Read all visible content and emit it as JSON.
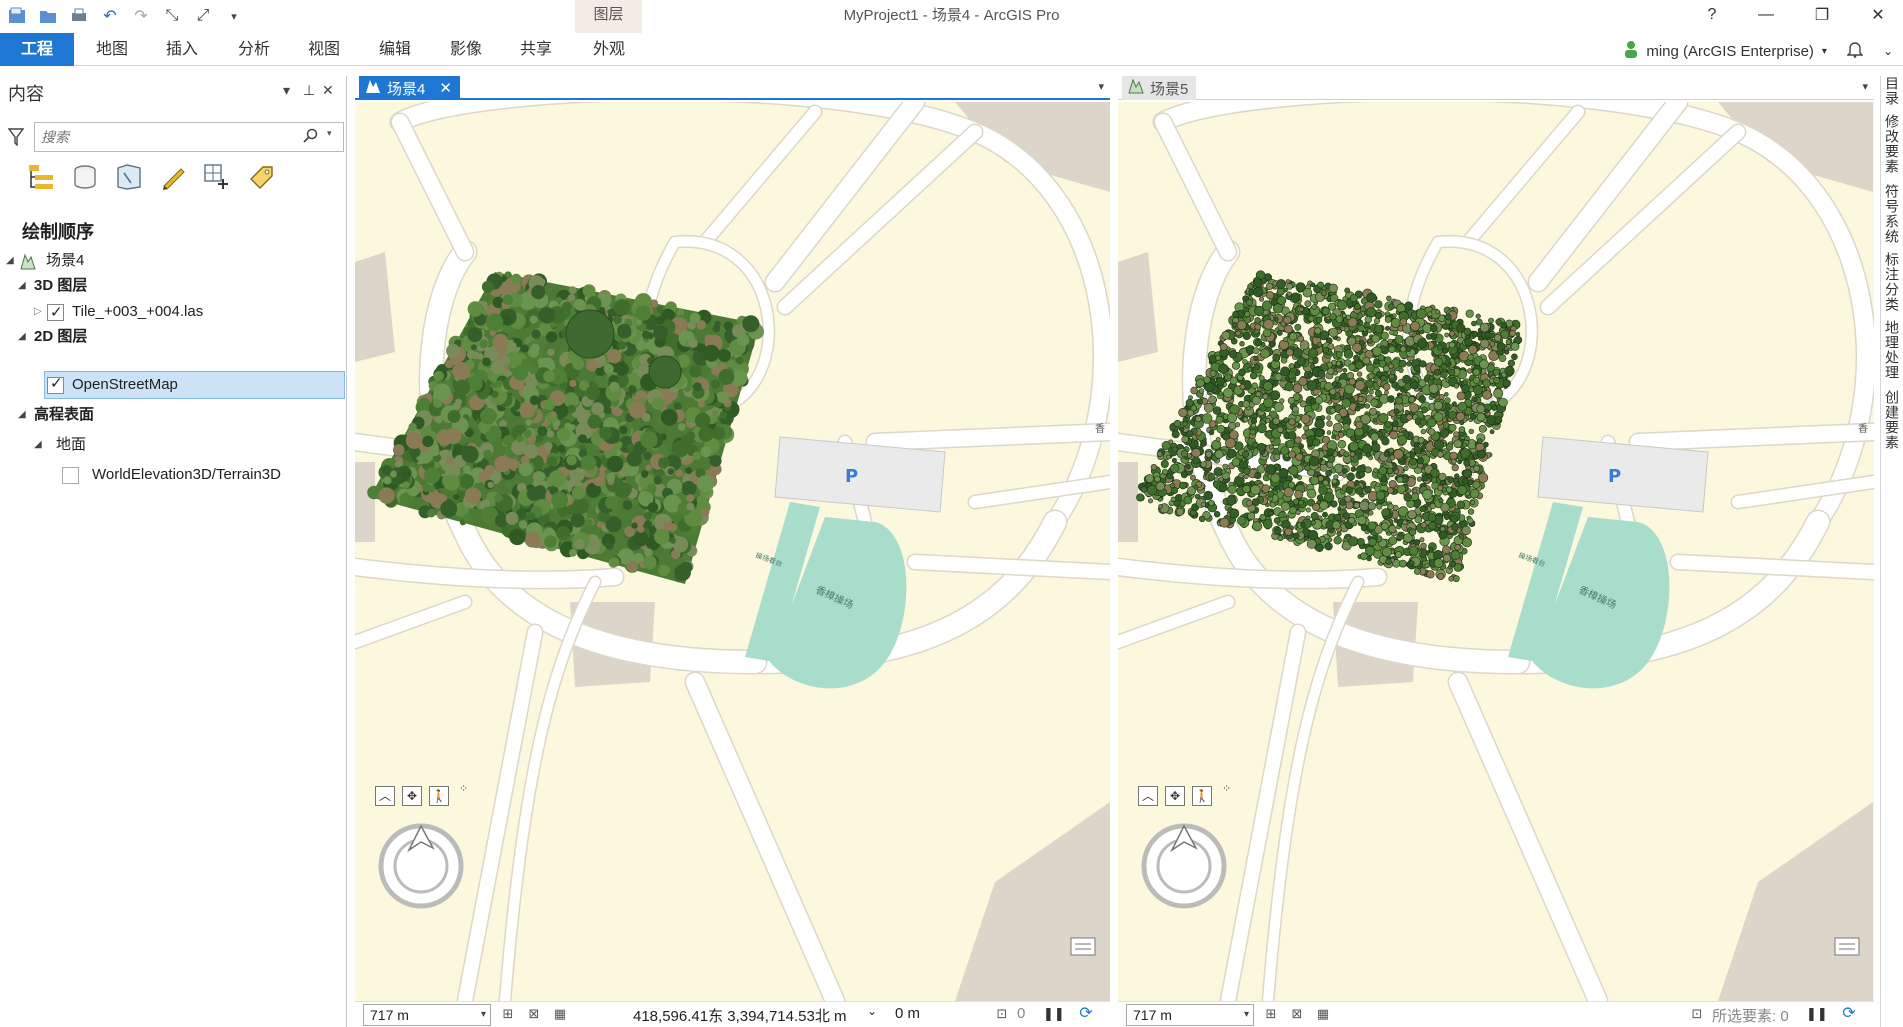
{
  "window": {
    "title": "MyProject1 - 场景4 - ArcGIS Pro",
    "context_tab_group": "图层",
    "controls": {
      "help": "?",
      "minimize": "—",
      "restore": "❐",
      "close": "✕"
    }
  },
  "quick_access": [
    "save-project-icon",
    "open-project-icon",
    "print-icon",
    "undo-icon",
    "redo-icon",
    "collapse-icon",
    "expand-icon",
    "customize-icon"
  ],
  "ribbon": {
    "tabs": [
      {
        "label": "工程",
        "active": true
      },
      {
        "label": "地图"
      },
      {
        "label": "插入"
      },
      {
        "label": "分析"
      },
      {
        "label": "视图"
      },
      {
        "label": "编辑"
      },
      {
        "label": "影像"
      },
      {
        "label": "共享"
      },
      {
        "label": "外观"
      }
    ],
    "user": "ming (ArcGIS Enterprise)"
  },
  "contents": {
    "title": "内容",
    "search_placeholder": "搜索",
    "draw_order_label": "绘制顺序",
    "tree": {
      "scene": "场景4",
      "group_3d": "3D 图层",
      "las_layer": "Tile_+003_+004.las",
      "group_2d": "2D 图层",
      "basemap_layer": "OpenStreetMap",
      "elevation": "高程表面",
      "ground": "地面",
      "terrain": "WorldElevation3D/Terrain3D"
    },
    "checked": {
      "las_layer": true,
      "basemap_layer": true,
      "terrain": false
    }
  },
  "views": [
    {
      "tab": "场景4",
      "active": true,
      "scale": "717 m",
      "coordinates": "418,596.41东 3,394,714.53北 m",
      "elevation": "0 m",
      "selected_count": "0"
    },
    {
      "tab": "场景5",
      "active": false,
      "scale": "717 m",
      "selected_label": "所选要素: 0"
    }
  ],
  "map_labels": {
    "parking": "P",
    "stadium": "香樟操场",
    "track_label": "操场看台",
    "road_label": "香"
  },
  "right_dock": [
    "目录",
    "修改要素",
    "符号系统",
    "标注分类",
    "地理处理",
    "创建要素"
  ],
  "colors": {
    "accent": "#1e78d3",
    "map_bg": "#fbf8de",
    "road": "#ffffff",
    "road_edge": "#dcd7c9",
    "building": "#ddd5ca",
    "stadium": "#a8dccb",
    "vegetation": "#4c7a34"
  }
}
